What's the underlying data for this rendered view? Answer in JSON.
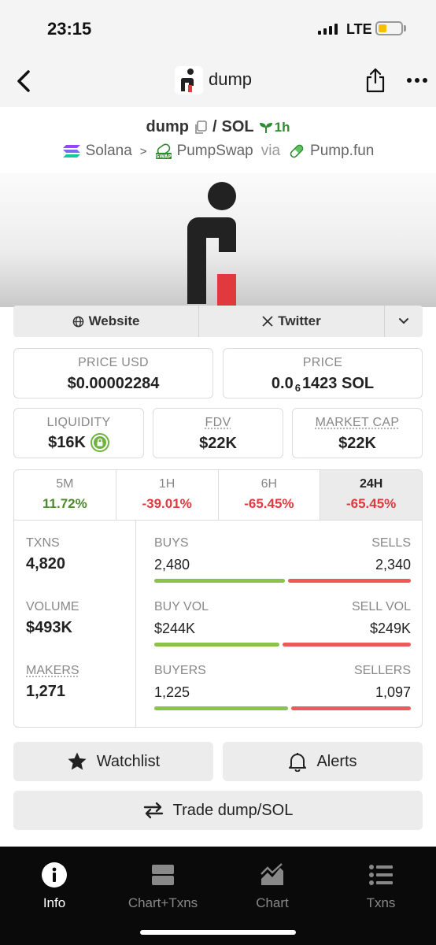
{
  "status_bar": {
    "time": "23:15",
    "carrier": "LTE"
  },
  "header": {
    "title": "dump"
  },
  "pair": {
    "base": "dump",
    "separator": "/",
    "quote": "SOL",
    "age": "1h",
    "chain": "Solana",
    "chevron": ">",
    "dex": "PumpSwap",
    "via": "via",
    "launchpad": "Pump.fun"
  },
  "links": {
    "website": "Website",
    "twitter": "Twitter"
  },
  "price": {
    "usd_label": "PRICE USD",
    "usd_value": "$0.00002284",
    "native_label": "PRICE",
    "native_prefix": "0.0",
    "native_zeros": "6",
    "native_suffix": "1423 SOL"
  },
  "metrics": {
    "liquidity_label": "LIQUIDITY",
    "liquidity_value": "$16K",
    "fdv_label": "FDV",
    "fdv_value": "$22K",
    "mcap_label": "MARKET CAP",
    "mcap_value": "$22K"
  },
  "timeframes": [
    {
      "label": "5M",
      "value": "11.72%",
      "trend": "up"
    },
    {
      "label": "1H",
      "value": "-39.01%",
      "trend": "down"
    },
    {
      "label": "6H",
      "value": "-65.45%",
      "trend": "down"
    },
    {
      "label": "24H",
      "value": "-65.45%",
      "trend": "down",
      "active": true
    }
  ],
  "txns": {
    "txns_label": "TXNS",
    "txns_value": "4,820",
    "volume_label": "VOLUME",
    "volume_value": "$493K",
    "makers_label": "MAKERS",
    "makers_value": "1,271",
    "buys_label": "BUYS",
    "buys_value": "2,480",
    "sells_label": "SELLS",
    "sells_value": "2,340",
    "buyvol_label": "BUY VOL",
    "buyvol_value": "$244K",
    "sellvol_label": "SELL VOL",
    "sellvol_value": "$249K",
    "buyers_label": "BUYERS",
    "buyers_value": "1,225",
    "sellers_label": "SELLERS",
    "sellers_value": "1,097",
    "buys_ratio": 0.515,
    "buyvol_ratio": 0.495,
    "buyers_ratio": 0.528
  },
  "actions": {
    "watchlist": "Watchlist",
    "alerts": "Alerts",
    "trade": "Trade dump/SOL"
  },
  "tabbar": [
    {
      "label": "Info",
      "icon": "info-icon",
      "active": true
    },
    {
      "label": "Chart+Txns",
      "icon": "chart-txns-icon"
    },
    {
      "label": "Chart",
      "icon": "chart-icon"
    },
    {
      "label": "Txns",
      "icon": "list-icon"
    }
  ],
  "colors": {
    "positive": "#4e8b2a",
    "negative": "#e0393e",
    "buy_bar": "#8bc34a",
    "sell_bar": "#ee5a5a",
    "age": "#2e8b2e"
  }
}
